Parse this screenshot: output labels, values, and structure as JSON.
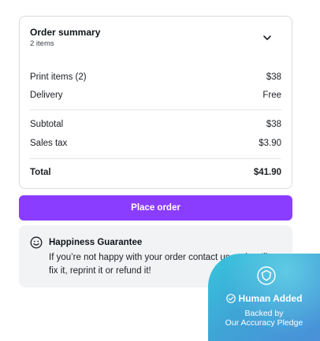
{
  "summary": {
    "title": "Order summary",
    "item_count": "2 items",
    "rows": [
      {
        "label": "Print items (2)",
        "value": "$38"
      },
      {
        "label": "Delivery",
        "value": "Free"
      },
      {
        "label": "Subtotal",
        "value": "$38"
      },
      {
        "label": "Sales tax",
        "value": "$3.90"
      },
      {
        "label": "Total",
        "value": "$41.90"
      }
    ]
  },
  "actions": {
    "place_order_label": "Place order",
    "button_color": "#8b3dff"
  },
  "guarantee": {
    "icon": "smile-icon",
    "title": "Happiness Guarantee",
    "text": "If you’re not happy with your order contact us and we’ll fix it, reprint it or refund it!"
  },
  "badge": {
    "icon": "shield-icon",
    "title": "Human Added",
    "line1": "Backed by",
    "line2": "Our Accuracy Pledge"
  }
}
